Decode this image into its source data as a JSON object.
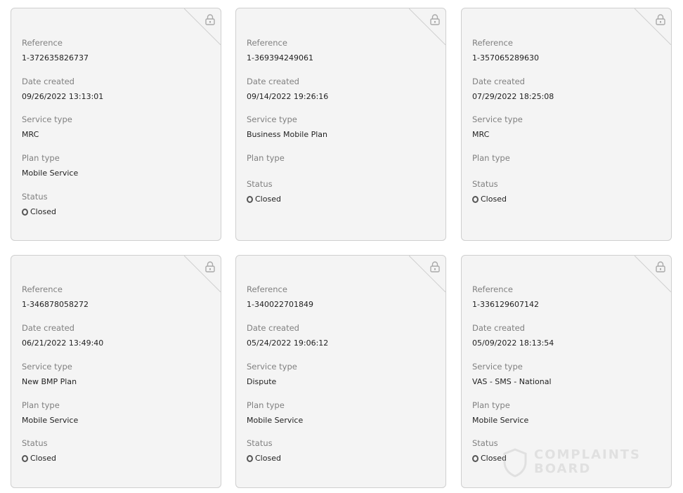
{
  "labels": {
    "reference": "Reference",
    "date_created": "Date created",
    "service_type": "Service type",
    "plan_type": "Plan type",
    "status": "Status"
  },
  "cards": [
    {
      "reference": "1-372635826737",
      "date_created": "09/26/2022 13:13:01",
      "service_type": "MRC",
      "plan_type": "Mobile Service",
      "status": "Closed"
    },
    {
      "reference": "1-369394249061",
      "date_created": "09/14/2022 19:26:16",
      "service_type": "Business Mobile Plan",
      "plan_type": "",
      "status": "Closed"
    },
    {
      "reference": "1-357065289630",
      "date_created": "07/29/2022 18:25:08",
      "service_type": "MRC",
      "plan_type": "",
      "status": "Closed"
    },
    {
      "reference": "1-346878058272",
      "date_created": "06/21/2022 13:49:40",
      "service_type": "New BMP Plan",
      "plan_type": "Mobile Service",
      "status": "Closed"
    },
    {
      "reference": "1-340022701849",
      "date_created": "05/24/2022 19:06:12",
      "service_type": "Dispute",
      "plan_type": "Mobile Service",
      "status": "Closed"
    },
    {
      "reference": "1-336129607142",
      "date_created": "05/09/2022 18:13:54",
      "service_type": "VAS - SMS - National",
      "plan_type": "Mobile Service",
      "status": "Closed"
    }
  ],
  "icons": {
    "card_corner": "lock-icon",
    "status": "status-circle-icon"
  },
  "watermark": {
    "line1": "COMPLAINTS",
    "line2": "BOARD"
  },
  "colors": {
    "card_bg": "#f4f4f4",
    "border": "#cfcfcf",
    "label": "#808080",
    "value": "#222222"
  }
}
